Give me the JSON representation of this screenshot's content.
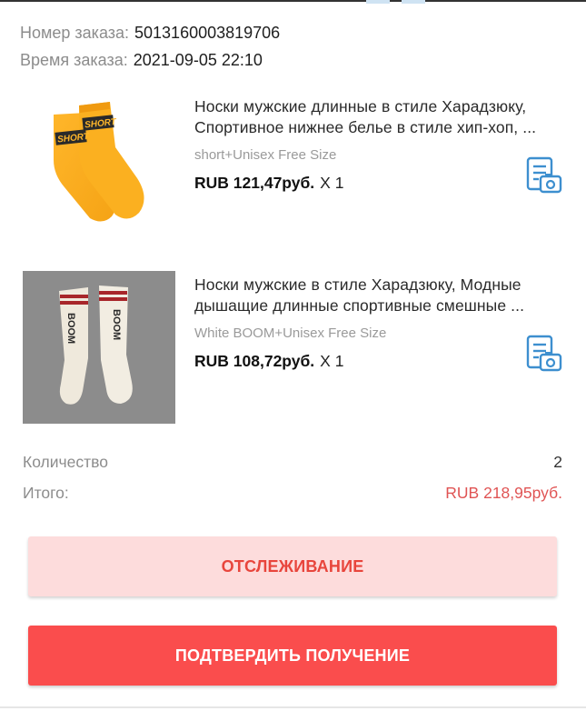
{
  "order": {
    "number_label": "Номер заказа:",
    "number_value": "5013160003819706",
    "time_label": "Время заказа:",
    "time_value": "2021-09-05 22:10"
  },
  "products": [
    {
      "title": "Носки мужские длинные в стиле Харадзюку, Спортивное нижнее белье в стиле хип-хоп, ...",
      "sku": "short+Unisex Free Size",
      "price": "RUB 121,47руб.",
      "qty": "X 1",
      "image_text": "SHORT",
      "icon": "review-photo-icon"
    },
    {
      "title": "Носки мужские в стиле Харадзюку, Модные дышащие длинные спортивные смешные ...",
      "sku": "White BOOM+Unisex Free Size",
      "price": "RUB 108,72руб.",
      "qty": "X 1",
      "image_text": "BOOM",
      "icon": "review-photo-icon"
    }
  ],
  "summary": {
    "quantity_label": "Количество",
    "quantity_value": "2",
    "total_label": "Итого:",
    "total_value": "RUB 218,95руб."
  },
  "buttons": {
    "track_label": "ОТСЛЕЖИВАНИЕ",
    "confirm_label": "ПОДТВЕРДИТЬ ПОЛУЧЕНИЕ"
  },
  "colors": {
    "accent_red": "#fa4d4d",
    "track_bg": "#fddcdc",
    "total_red": "#e05454",
    "icon_blue": "#3d8fcf"
  }
}
